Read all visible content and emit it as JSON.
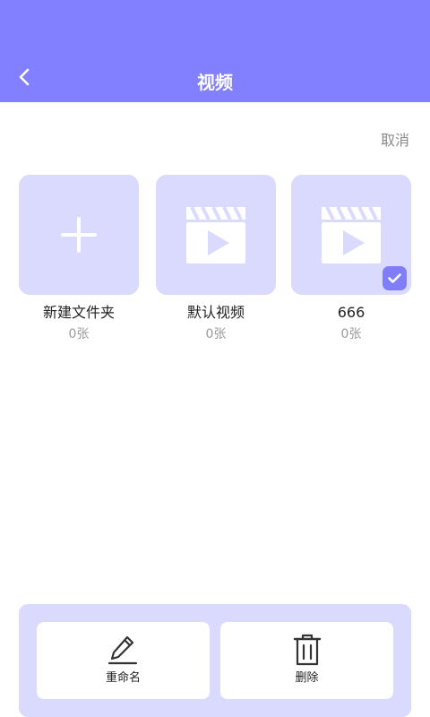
{
  "header": {
    "title": "视频",
    "back_icon": "chevron-left-icon",
    "background": "#8280ff"
  },
  "toolbar": {
    "cancel_label": "取消"
  },
  "folders": [
    {
      "name": "新建文件夹",
      "count": "0张",
      "icon": "plus-icon"
    },
    {
      "name": "默认视频",
      "count": "0张",
      "icon": "video-clapper-icon"
    },
    {
      "name": "666",
      "count": "0张",
      "icon": "video-clapper-icon",
      "selected": true
    }
  ],
  "actions": {
    "rename_label": "重命名",
    "delete_label": "删除"
  },
  "colors": {
    "accent": "#8280ff",
    "tile_bg": "#dadafe",
    "check_bg": "#7f7dfa"
  }
}
